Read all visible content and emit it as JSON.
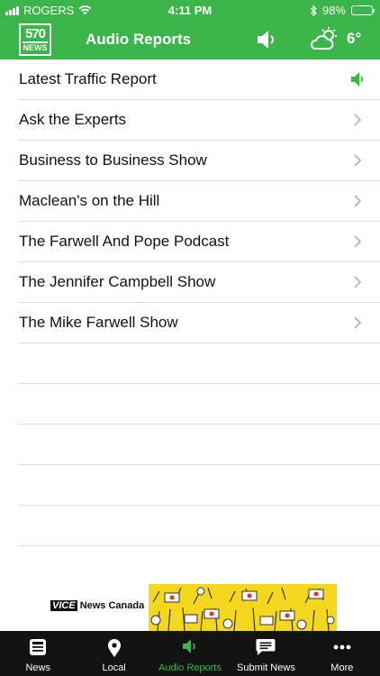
{
  "status_bar": {
    "carrier": "ROGERS",
    "time": "4:11 PM",
    "battery": "98%",
    "battery_level": 0.98
  },
  "header": {
    "logo_number": "570",
    "logo_word": "NEWS",
    "title": "Audio Reports",
    "temperature": "6°",
    "weather_icon": "partly-sunny-icon"
  },
  "list": {
    "items": [
      {
        "label": "Latest Traffic Report",
        "accessory": "speaker-icon"
      },
      {
        "label": "Ask the Experts",
        "accessory": "chevron-right-icon"
      },
      {
        "label": "Business to Business Show",
        "accessory": "chevron-right-icon"
      },
      {
        "label": "Maclean's on the Hill",
        "accessory": "chevron-right-icon"
      },
      {
        "label": "The Farwell And Pope Podcast",
        "accessory": "chevron-right-icon"
      },
      {
        "label": "The Jennifer Campbell Show",
        "accessory": "chevron-right-icon"
      },
      {
        "label": "The Mike Farwell Show",
        "accessory": "chevron-right-icon"
      }
    ]
  },
  "ad": {
    "brand_logo": "VICE",
    "brand_name": "News Canada"
  },
  "tabbar": {
    "active_color": "#3bb44a",
    "tabs": [
      {
        "label": "News",
        "icon": "newspaper-icon"
      },
      {
        "label": "Local",
        "icon": "location-pin-icon"
      },
      {
        "label": "Audio Reports",
        "icon": "speaker-icon",
        "active": true
      },
      {
        "label": "Submit News",
        "icon": "message-icon"
      },
      {
        "label": "More",
        "icon": "more-dots-icon"
      }
    ]
  },
  "colors": {
    "brand_green": "#3bb44a",
    "tabbar_bg": "#121212",
    "divider": "#dcdcdc"
  }
}
